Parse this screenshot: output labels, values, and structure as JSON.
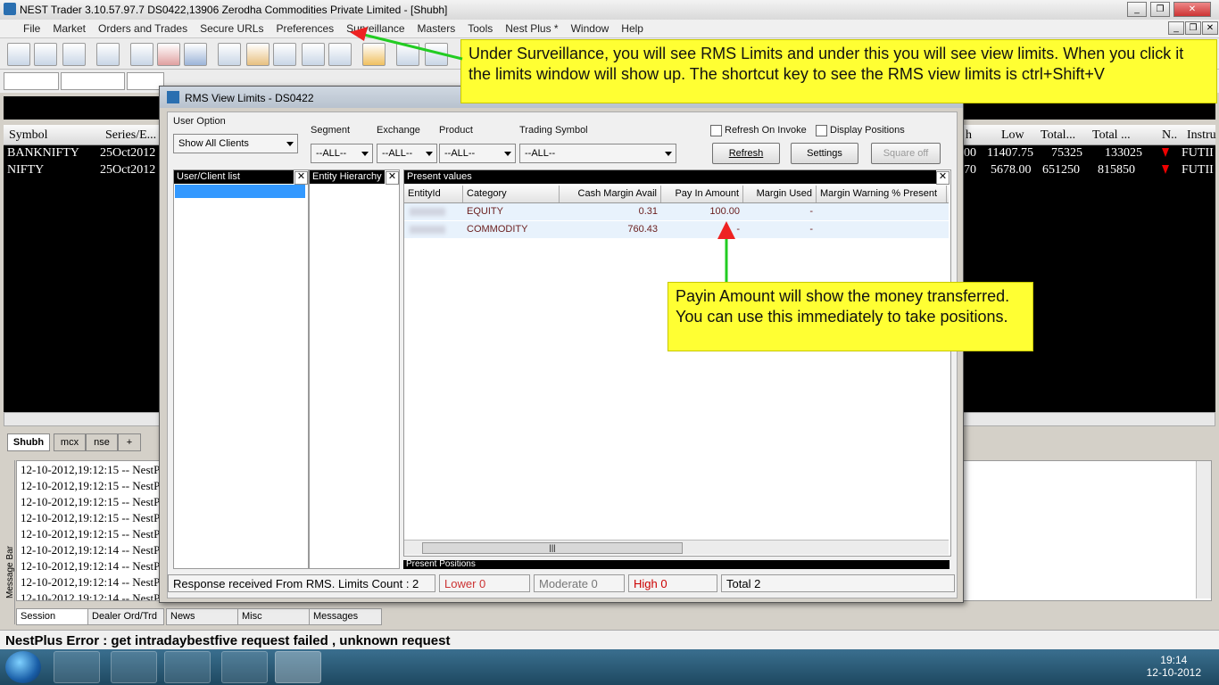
{
  "window": {
    "title": "NEST Trader 3.10.57.97.7 DS0422,13906 Zerodha Commodities Private Limited - [Shubh]"
  },
  "menu": [
    "File",
    "Market",
    "Orders and Trades",
    "Secure URLs",
    "Preferences",
    "Surveillance",
    "Masters",
    "Tools",
    "Nest Plus *",
    "Window",
    "Help"
  ],
  "market_watch": {
    "headers": [
      "Symbol",
      "Series/E...",
      "h",
      "Low",
      "Total...",
      "Total ...",
      "N..",
      "Instru"
    ],
    "rows": [
      {
        "symbol": "BANKNIFTY",
        "series": "25Oct2012",
        "high": "00",
        "low": "11407.75",
        "total1": "75325",
        "total2": "133025",
        "instr": "FUTII"
      },
      {
        "symbol": "NIFTY",
        "series": "25Oct2012",
        "high": "70",
        "low": "5678.00",
        "total1": "651250",
        "total2": "815850",
        "instr": "FUTII"
      }
    ],
    "tabs": [
      "Shubh",
      "mcx",
      "nse",
      "+"
    ]
  },
  "dialog": {
    "title": "RMS View Limits - DS0422",
    "user_option_label": "User Option",
    "user_option_value": "Show All Clients",
    "segment_label": "Segment",
    "segment_value": "--ALL--",
    "exchange_label": "Exchange",
    "exchange_value": "--ALL--",
    "product_label": "Product",
    "product_value": "--ALL--",
    "symbol_label": "Trading Symbol",
    "symbol_value": "--ALL--",
    "refresh_on_invoke": "Refresh On Invoke",
    "display_positions": "Display Positions",
    "refresh_btn": "Refresh",
    "settings_btn": "Settings",
    "squareoff_btn": "Square off",
    "client_list_title": "User/Client list",
    "entity_title": "Entity Hierarchy",
    "present_values_title": "Present values",
    "present_positions_title": "Present Positions",
    "columns": [
      "EntityId",
      "Category",
      "Cash Margin Avail",
      "Pay In Amount",
      "Margin Used",
      "Margin Warning % Present"
    ],
    "rows": [
      {
        "category": "EQUITY",
        "cash": "0.31",
        "payin": "100.00",
        "used": "-"
      },
      {
        "category": "COMMODITY",
        "cash": "760.43",
        "payin": "-",
        "used": "-"
      }
    ],
    "status": {
      "response": "Response received From RMS. Limits Count : 2",
      "lower": "Lower 0",
      "moderate": "Moderate 0",
      "high": "High 0",
      "total": "Total 2"
    }
  },
  "annotations": {
    "top": "Under Surveillance, you will see RMS Limits and under this you will see view limits. When you click it the limits window will show up. The shortcut key to see the RMS view limits is ctrl+Shift+V",
    "payin": "Payin Amount will show the money transferred. You can use this immediately to take positions."
  },
  "messages": {
    "lines": [
      "12-10-2012,19:12:15  -- NestP",
      "12-10-2012,19:12:15  -- NestP",
      "12-10-2012,19:12:15  -- NestP",
      "12-10-2012,19:12:15  -- NestP",
      "12-10-2012,19:12:15  -- NestP",
      "12-10-2012,19:12:14  -- NestP",
      "12-10-2012,19:12:14  -- NestP",
      "12-10-2012,19:12:14  -- NestP",
      "12-10-2012,19:12:14  -- NestP"
    ],
    "side_label": "Message Bar",
    "tabs": [
      "Session",
      "Dealer Ord/Trd",
      "News",
      "Misc",
      "Messages"
    ]
  },
  "status_error": "NestPlus Error : get intradaybestfive request failed , unknown request",
  "taskbar": {
    "time": "19:14",
    "date": "12-10-2012"
  },
  "colors": {
    "note_yellow": "#ffff33",
    "arrow_green": "#22cc22",
    "grid_black": "#000000",
    "category_text": "#6b2020"
  }
}
